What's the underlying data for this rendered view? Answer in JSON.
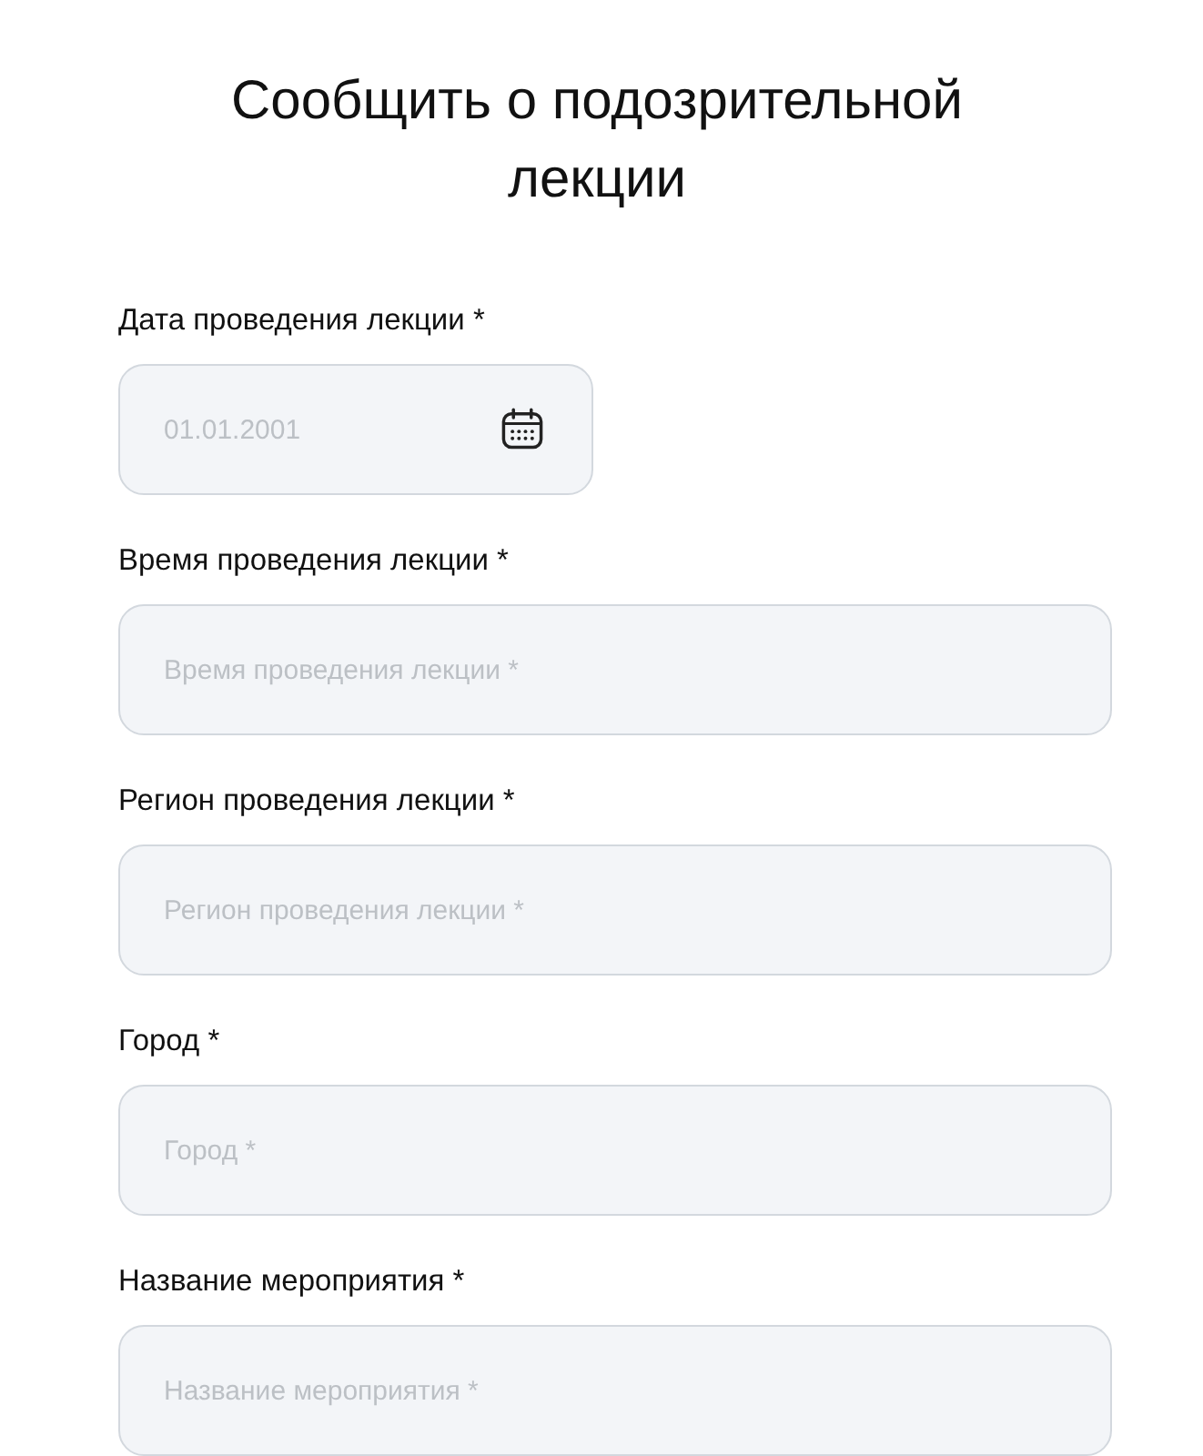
{
  "title": "Сообщить о подозрительной лекции",
  "fields": [
    {
      "kind": "date",
      "label": "Дата проведения лекции *",
      "placeholder": "01.01.2001"
    },
    {
      "kind": "text",
      "label": "Время проведения лекции *",
      "placeholder": "Время проведения лекции *"
    },
    {
      "kind": "text",
      "label": "Регион проведения лекции *",
      "placeholder": "Регион проведения лекции *"
    },
    {
      "kind": "text",
      "label": "Город *",
      "placeholder": "Город *"
    },
    {
      "kind": "text",
      "label": "Название мероприятия *",
      "placeholder": "Название мероприятия *"
    }
  ]
}
